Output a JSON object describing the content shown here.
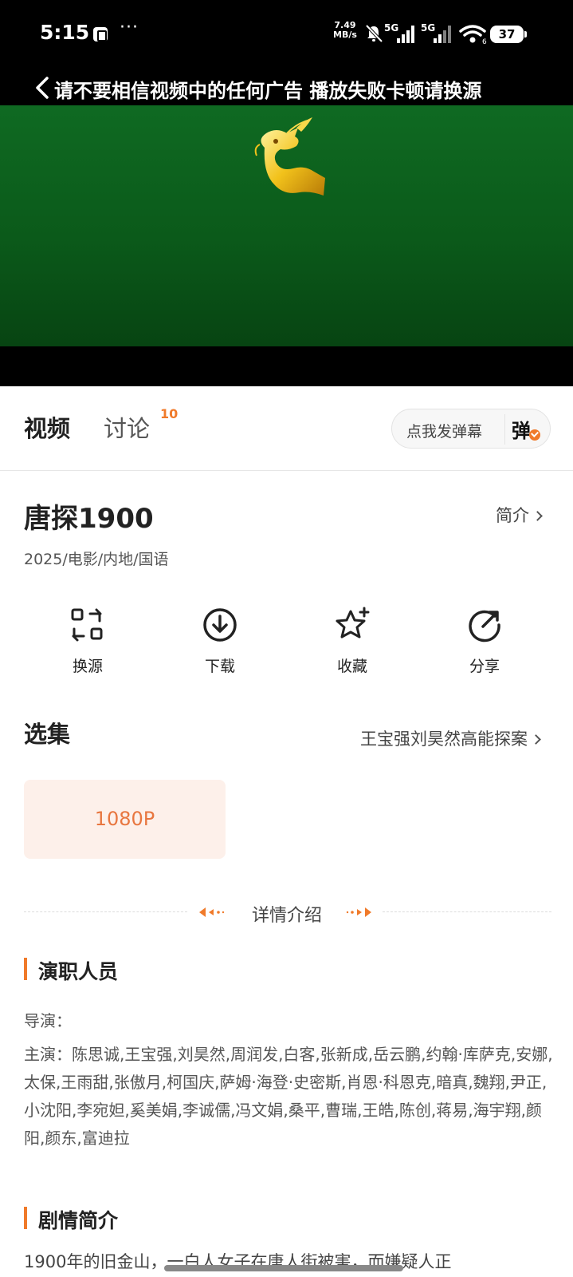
{
  "status_bar": {
    "time": "5:15",
    "more": "···",
    "net_speed_value": "7.49",
    "net_speed_unit": "MB/s",
    "signal_1_label": "5G",
    "signal_2_label": "5G",
    "wifi_level": "6",
    "battery": "37"
  },
  "player": {
    "title": "请不要相信视频中的任何广告 播放失败卡顿请换源"
  },
  "tabs": {
    "video": "视频",
    "discuss": "讨论",
    "discuss_badge": "10",
    "danmu_placeholder": "点我发弹幕",
    "danmu_toggle": "弹"
  },
  "movie": {
    "title": "唐探1900",
    "intro_link": "简介",
    "meta": "2025/电影/内地/国语"
  },
  "actions": [
    {
      "label": "换源",
      "icon": "switch-source-icon"
    },
    {
      "label": "下载",
      "icon": "download-icon"
    },
    {
      "label": "收藏",
      "icon": "favorite-star-icon"
    },
    {
      "label": "分享",
      "icon": "share-icon"
    }
  ],
  "episodes": {
    "title": "选集",
    "link": "王宝强刘昊然高能探案",
    "items": [
      "1080P"
    ]
  },
  "details": {
    "divider_label": "详情介绍",
    "cast_heading": "演职人员",
    "director": "导演：",
    "cast": "主演：陈思诚,王宝强,刘昊然,周润发,白客,张新成,岳云鹏,约翰·库萨克,安娜,太保,王雨甜,张傲月,柯国庆,萨姆·海登·史密斯,肖恩·科恩克,暗真,魏翔,尹正,小沈阳,李宛妲,奚美娟,李诚儒,冯文娟,桑平,曹瑞,王皓,陈创,蒋易,海宇翔,颜阳,颜东,富迪拉",
    "plot_heading": "剧情简介",
    "plot": "1900年的旧金山，一白人女子在唐人街被害，而嫌疑人正"
  },
  "colors": {
    "accent": "#f07a2a",
    "episode_bg": "#fdf0ea",
    "video_green": "#0b5a1a"
  }
}
